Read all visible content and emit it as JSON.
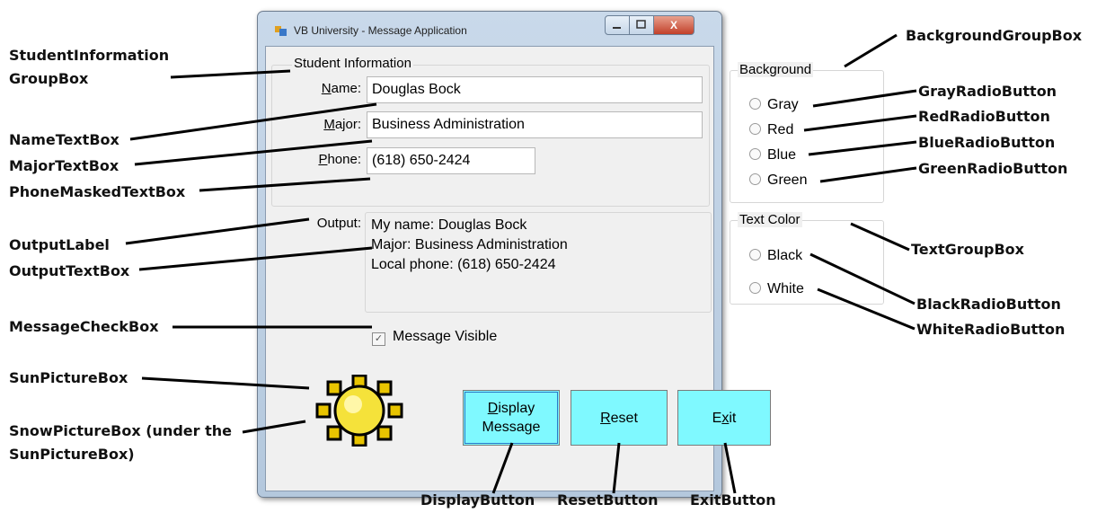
{
  "window": {
    "title": "VB University - Message Application",
    "close_glyph": "X"
  },
  "student_group": {
    "title": "Student Information",
    "name_label_key": "N",
    "name_label_rest": "ame:",
    "name_value": "Douglas Bock",
    "major_label_key": "M",
    "major_label_rest": "ajor:",
    "major_value": "Business Administration",
    "phone_label_key": "P",
    "phone_label_rest": "hone:",
    "phone_value": "(618) 650-2424"
  },
  "output": {
    "label": "Output:",
    "lines": [
      "My name: Douglas Bock",
      "Major: Business Administration",
      "Local phone: (618) 650-2424"
    ]
  },
  "background_group": {
    "title": "Background",
    "options": [
      "Gray",
      "Red",
      "Blue",
      "Green"
    ]
  },
  "text_group": {
    "title": "Text Color",
    "options": [
      "Black",
      "White"
    ]
  },
  "message_check": {
    "label": "Message Visible",
    "checked": true,
    "check_glyph": "✓"
  },
  "buttons": {
    "display_key": "D",
    "display_rest": "isplay",
    "display_line2": "Message",
    "reset_key": "R",
    "reset_rest": "eset",
    "exit_pre": "E",
    "exit_key": "x",
    "exit_post": "it",
    "color": "#7ff9ff"
  },
  "annotations": {
    "student_info_1": "StudentInformation",
    "student_info_2": "GroupBox",
    "name_tb": "NameTextBox",
    "major_tb": "MajorTextBox",
    "phone_tb": "PhoneMaskedTextBox",
    "output_label": "OutputLabel",
    "output_tb": "OutputTextBox",
    "message_cb": "MessageCheckBox",
    "sun_pb": "SunPictureBox",
    "snow_pb_1": "SnowPictureBox (under the",
    "snow_pb_2": "SunPictureBox)",
    "bg_group": "BackgroundGroupBox",
    "gray_rb": "GrayRadioButton",
    "red_rb": "RedRadioButton",
    "blue_rb": "BlueRadioButton",
    "green_rb": "GreenRadioButton",
    "text_group": "TextGroupBox",
    "black_rb": "BlackRadioButton",
    "white_rb": "WhiteRadioButton",
    "display_btn": "DisplayButton",
    "reset_btn": "ResetButton",
    "exit_btn": "ExitButton"
  }
}
